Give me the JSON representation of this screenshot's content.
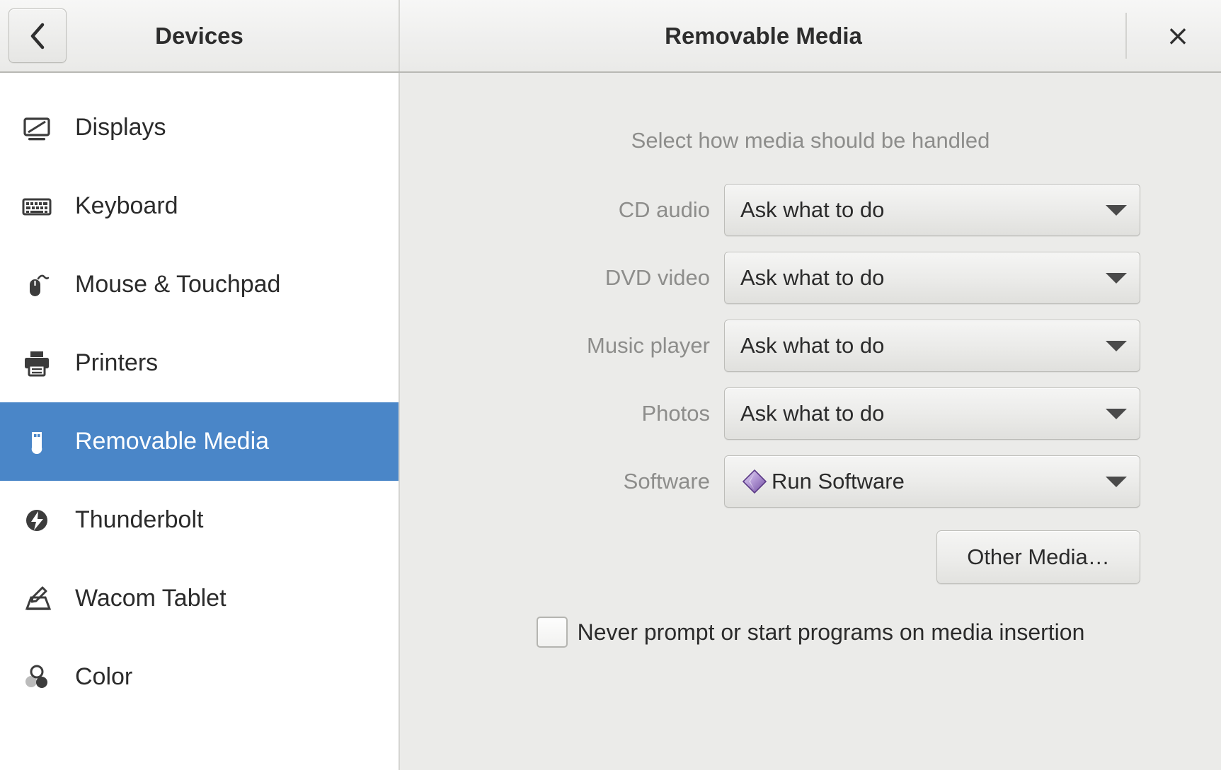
{
  "header": {
    "back_icon": "chevron-left-icon",
    "left_title": "Devices",
    "right_title": "Removable Media",
    "close_label": "×"
  },
  "sidebar": {
    "items": [
      {
        "label": "Displays",
        "icon": "display-icon"
      },
      {
        "label": "Keyboard",
        "icon": "keyboard-icon"
      },
      {
        "label": "Mouse & Touchpad",
        "icon": "mouse-icon"
      },
      {
        "label": "Printers",
        "icon": "printer-icon"
      },
      {
        "label": "Removable Media",
        "icon": "usb-drive-icon",
        "selected": true
      },
      {
        "label": "Thunderbolt",
        "icon": "thunderbolt-icon"
      },
      {
        "label": "Wacom Tablet",
        "icon": "wacom-tablet-icon"
      },
      {
        "label": "Color",
        "icon": "color-icon"
      }
    ],
    "selected_color": "#4a86c8"
  },
  "content": {
    "subtitle": "Select how media should be handled",
    "rows": [
      {
        "label": "CD audio",
        "value": "Ask what to do",
        "icon": null
      },
      {
        "label": "DVD video",
        "value": "Ask what to do",
        "icon": null
      },
      {
        "label": "Music player",
        "value": "Ask what to do",
        "icon": null
      },
      {
        "label": "Photos",
        "value": "Ask what to do",
        "icon": null
      },
      {
        "label": "Software",
        "value": "Run Software",
        "icon": "software-diamond-icon"
      }
    ],
    "other_media_label": "Other Media…",
    "never_prompt_label": "Never prompt or start programs on media insertion",
    "never_prompt_checked": false
  },
  "colors": {
    "sidebar_bg": "#ffffff",
    "content_bg": "#ebebe9",
    "header_bg": "#efefee",
    "accent": "#4a86c8",
    "muted_text": "#8d8d8b",
    "text": "#2b2b2b"
  }
}
